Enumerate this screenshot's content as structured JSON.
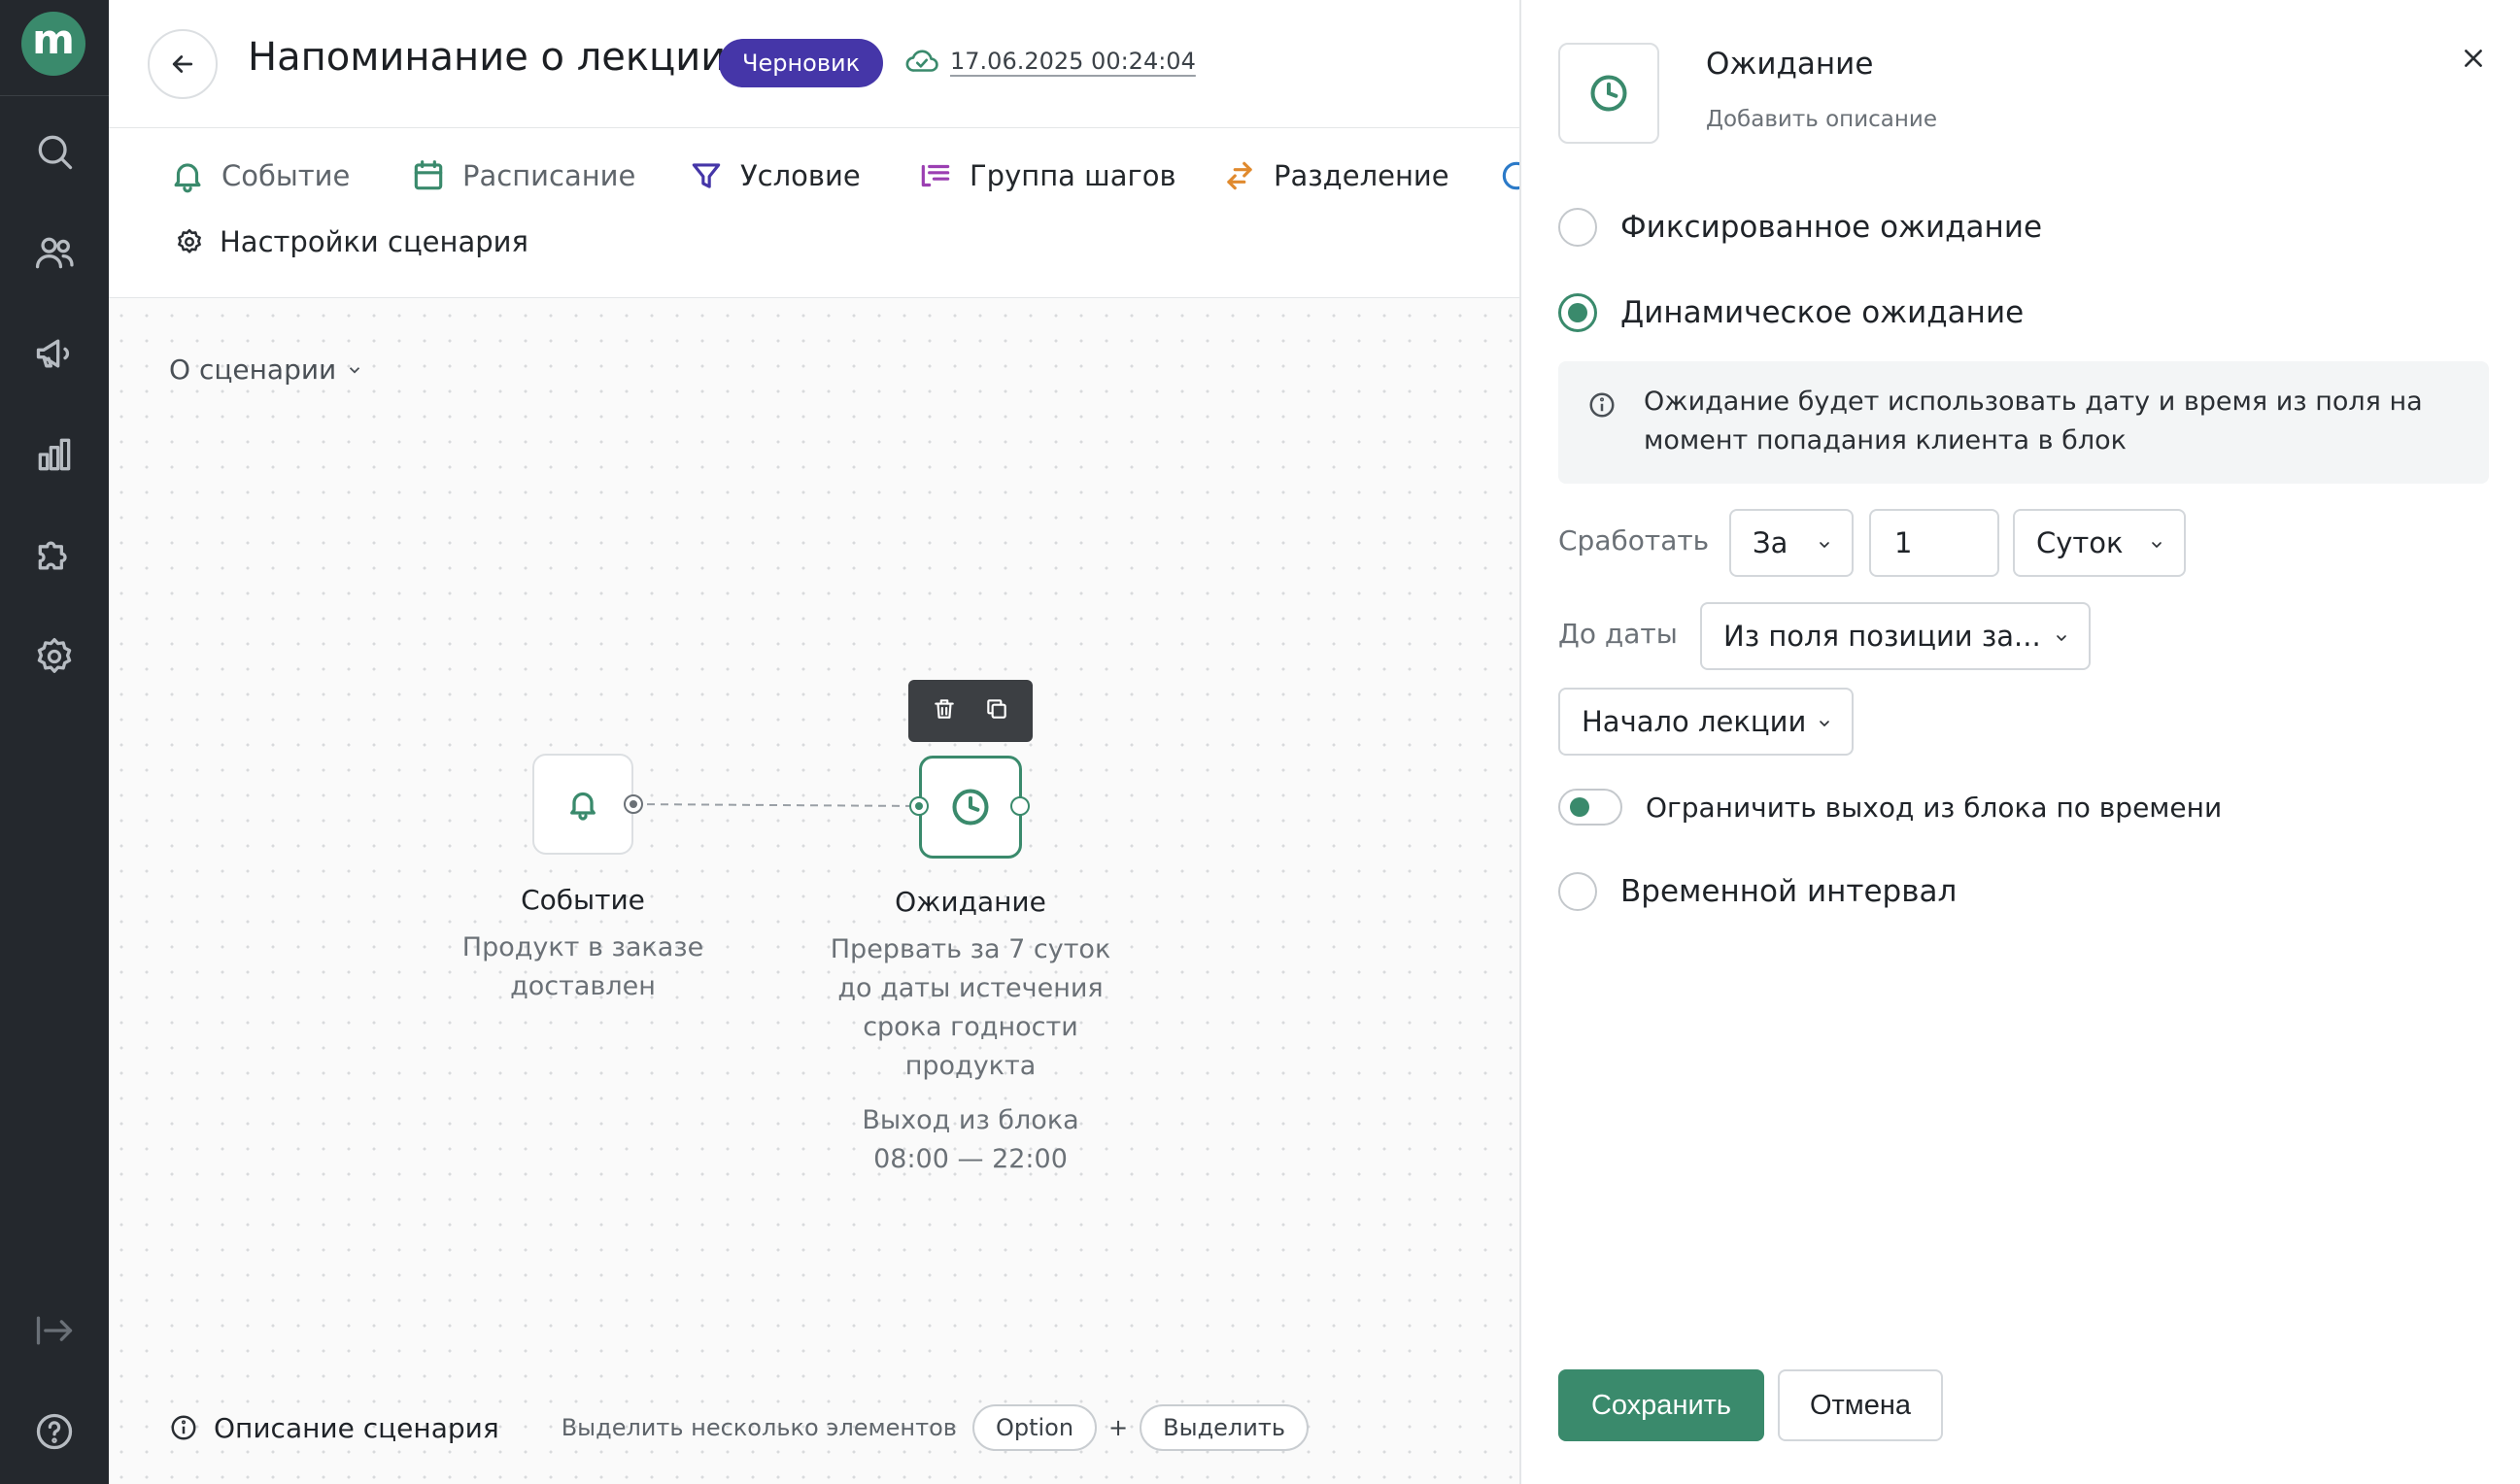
{
  "app": {
    "logo_letter": "m"
  },
  "sidebar": {
    "items": [
      {
        "icon": "search-icon"
      },
      {
        "icon": "users-icon"
      },
      {
        "icon": "megaphone-icon"
      },
      {
        "icon": "chart-icon"
      },
      {
        "icon": "puzzle-icon"
      },
      {
        "icon": "gear-icon"
      },
      {
        "icon": "collapse-icon"
      },
      {
        "icon": "help-icon"
      }
    ]
  },
  "header": {
    "title": "Напоминание о лекции",
    "badge": "Черновик",
    "saved_at": "17.06.2025 00:24:04"
  },
  "toolbar": {
    "items": [
      {
        "label": "Событие",
        "icon": "bell-icon"
      },
      {
        "label": "Расписание",
        "icon": "calendar-icon"
      },
      {
        "label": "Условие",
        "icon": "filter-icon"
      },
      {
        "label": "Группа шагов",
        "icon": "steps-group-icon"
      },
      {
        "label": "Разделение",
        "icon": "split-icon"
      },
      {
        "label": "Настройки сценария",
        "icon": "gear-icon"
      }
    ]
  },
  "canvas": {
    "about_label": "О сценарии",
    "nodes": [
      {
        "title": "Событие",
        "description": "Продукт в заказе доставлен",
        "icon": "bell-icon"
      },
      {
        "title": "Ожидание",
        "description_lines": [
          "Прервать за 7 суток",
          "до даты истечения",
          "срока годности",
          "продукта"
        ],
        "exit_lines": [
          "Выход из блока",
          "08:00 — 22:00"
        ],
        "icon": "clock-icon"
      }
    ],
    "bottom": {
      "description_label": "Описание сценария",
      "hint": "Выделить несколько элементов",
      "key_option": "Option",
      "plus": "+",
      "key_select": "Выделить"
    }
  },
  "panel": {
    "title": "Ожидание",
    "subtitle": "Добавить описание",
    "options": {
      "fixed": "Фиксированное ожидание",
      "dynamic": "Динамическое ожидание",
      "interval": "Временной интервал"
    },
    "selected_option": "dynamic",
    "info_text": "Ожидание будет использовать дату и время из поля на момент попадания клиента в блок",
    "trigger_label": "Сработать",
    "trigger_direction": "За",
    "trigger_amount": "1",
    "trigger_unit": "Суток",
    "until_label": "До даты",
    "until_source": "Из поля позиции за...",
    "until_field": "Начало лекции",
    "limit_toggle_label": "Ограничить выход из блока по времени",
    "save_label": "Сохранить",
    "cancel_label": "Отмена"
  },
  "colors": {
    "accent": "#3a8a6c",
    "badge": "#4536a8",
    "sidebar": "#24282d"
  }
}
